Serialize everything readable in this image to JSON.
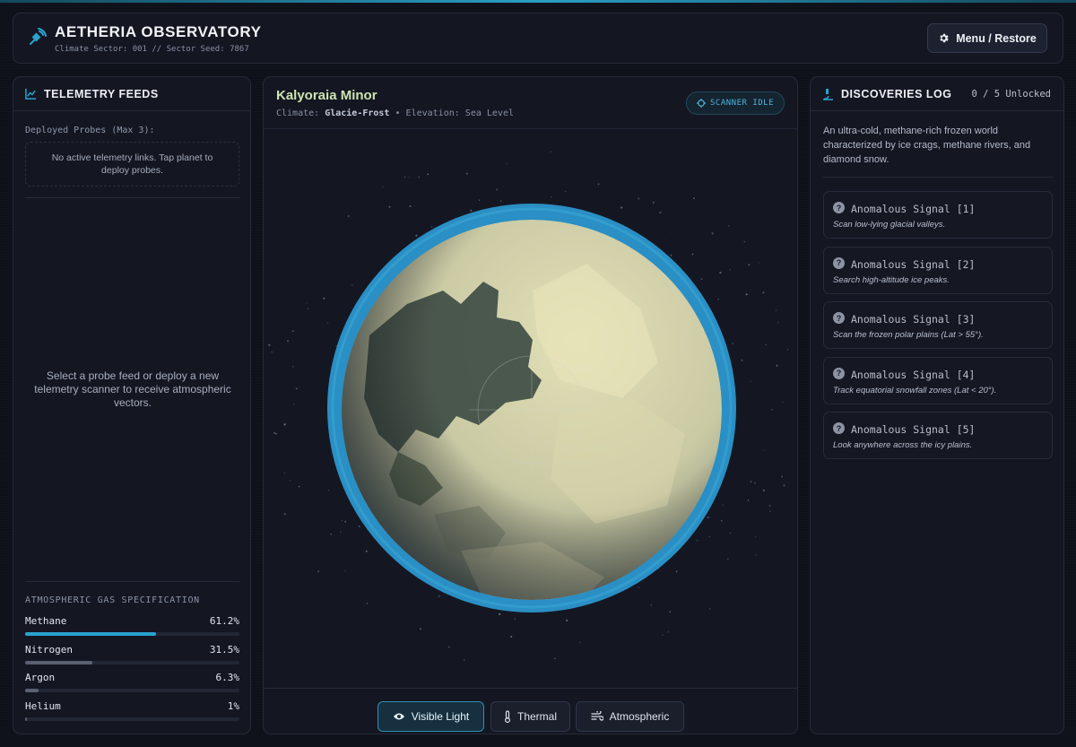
{
  "header": {
    "title": "AETHERIA OBSERVATORY",
    "subtitle": "Climate Sector: 001 // Sector Seed: 7867",
    "menu_label": "Menu / Restore"
  },
  "telemetry": {
    "title": "TELEMETRY FEEDS",
    "probes_label": "Deployed Probes (Max 3):",
    "probes_empty": "No active telemetry links. Tap planet to deploy probes.",
    "select_message": "Select a probe feed or deploy a new telemetry scanner to receive atmospheric vectors.",
    "gas_title": "ATMOSPHERIC GAS SPECIFICATION",
    "gases": [
      {
        "name": "Methane",
        "value": "61.2%",
        "fraction": 0.612,
        "color": "#2aa3cf"
      },
      {
        "name": "Nitrogen",
        "value": "31.5%",
        "fraction": 0.315,
        "color": "#5b6072"
      },
      {
        "name": "Argon",
        "value": "6.3%",
        "fraction": 0.063,
        "color": "#5b6072"
      },
      {
        "name": "Helium",
        "value": "1%",
        "fraction": 0.01,
        "color": "#5b6072"
      }
    ]
  },
  "planet": {
    "name": "Kalyoraia Minor",
    "climate_label": "Climate:",
    "climate_value": "Glacie-Frost",
    "separator": "•",
    "elevation_label": "Elevation:",
    "elevation_value": "Sea Level",
    "scanner_status": "SCANNER IDLE",
    "colors": {
      "ocean_ring": "#2a8fc4",
      "ice": "#d7d7b0",
      "dark": "#3e4a42"
    }
  },
  "view_modes": [
    {
      "label": "Visible Light",
      "icon": "eye-icon",
      "active": true
    },
    {
      "label": "Thermal",
      "icon": "thermometer-icon",
      "active": false
    },
    {
      "label": "Atmospheric",
      "icon": "wind-icon",
      "active": false
    }
  ],
  "discoveries": {
    "title": "DISCOVERIES LOG",
    "unlocked": "0 / 5 Unlocked",
    "description": "An ultra-cold, methane-rich frozen world characterized by ice crags, methane rivers, and diamond snow.",
    "signals": [
      {
        "title": "Anomalous Signal [1]",
        "hint": "Scan low-lying glacial valleys."
      },
      {
        "title": "Anomalous Signal [2]",
        "hint": "Search high-altitude ice peaks."
      },
      {
        "title": "Anomalous Signal [3]",
        "hint": "Scan the frozen polar plains (Lat > 55°)."
      },
      {
        "title": "Anomalous Signal [4]",
        "hint": "Track equatorial snowfall zones (Lat < 20°)."
      },
      {
        "title": "Anomalous Signal [5]",
        "hint": "Look anywhere across the icy plains."
      }
    ]
  }
}
